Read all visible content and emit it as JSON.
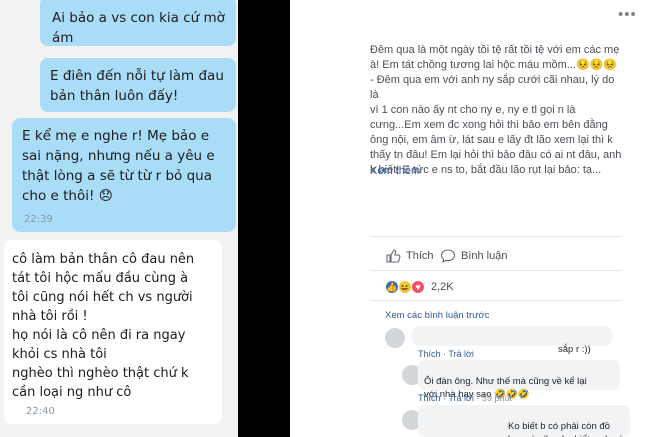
{
  "chat": {
    "messages": [
      {
        "text": "Ai bảo a vs con kia cứ mờ\nám"
      },
      {
        "text": "E điên đến nỗi tự làm đau\nbản thân luôn đấy!"
      },
      {
        "text": "E kể mẹ e nghe r! Mẹ bảo e\nsai nặng, nhưng nếu a yêu e\nthật lòng a sẽ từ từ r bỏ qua\ncho e thôi! 😞",
        "time": "22:39"
      },
      {
        "text": "cô làm bản thân cô đau nên\ntát tôi hộc mấu đầu cùng à\ntôi cũng nói hết ch vs người\nnhà tôi rồi !\nhọ nói là cô nên đi ra ngay\nkhỏi cs nhà tôi\nnghèo thì nghèo thật chứ k\ncần loại ng như cô",
        "time": "22:40"
      }
    ]
  },
  "post": {
    "text": "Đêm qua là một ngày tồi tệ rất tồi tệ với em các mẹ\nà! Em tát chồng tương lai hộc máu mồm...😣😣😣\n- Đêm qua em với anh ny sắp cưới cãi nhau, lý do là\nvì 1 con         nào ấy nt cho ny e, ny e tl gọi n là\ncưng...Em xem đc xong hỏi thì bảo em bên đằng\nông nội, em âm ừ, lát sau e lấy đt lão xem lại thì k\nthấy tn đâu! Em lại hỏi thì bảo đâu có ai nt đâu, anh\nk biết! E tức e ns to, bắt đầu lão rụt lại bảo: tạ...",
    "see_more": "Xem thêm",
    "like_label": "Thích",
    "comment_label": "Bình luận",
    "reaction_count": "2,2K",
    "previous_comments": "Xem các bình luận trước",
    "comments": [
      {
        "text": "sắp r :))",
        "like": "Thích",
        "reply": "Trả lời",
        "time": ""
      },
      {
        "text": "Ôi đàn ông. Như thế mà cũng về kể lại\nvới nhà hay sao 🤣🤣🤣",
        "like": "Thích",
        "reply": "Trả lời",
        "time": "59 phút"
      },
      {
        "text": "Ko biết b có phải còn đồ\nko.. và cũng ko biết nv b có phải bóng ko.. Mà sao t"
      }
    ]
  },
  "colors": {
    "sent_bubble": "#a9dcf6",
    "received_bubble": "#ffffff",
    "chat_background": "#f2f2f2",
    "link": "#365899"
  },
  "icons": [
    "thumbs-up-icon",
    "speech-bubble-icon",
    "more-dots-icon",
    "like-reaction-icon",
    "haha-reaction-icon",
    "love-reaction-icon"
  ]
}
